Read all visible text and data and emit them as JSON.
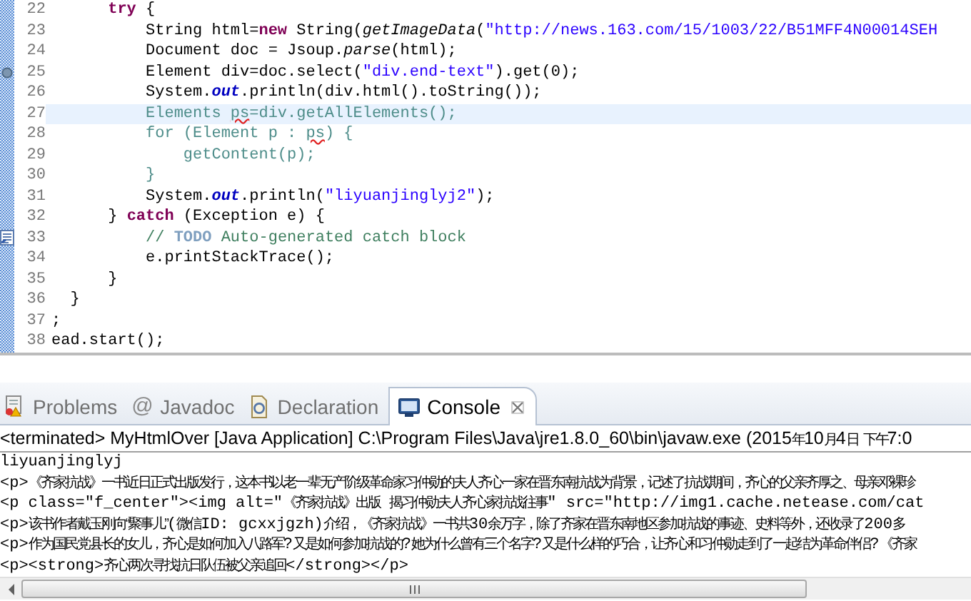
{
  "editor": {
    "lines": [
      {
        "number": "22",
        "breakpoint": false,
        "task": false,
        "current": false,
        "tokens": [
          {
            "kind": "keyword",
            "text": "      try"
          },
          {
            "kind": "plain",
            "text": " {"
          }
        ]
      },
      {
        "number": "23",
        "breakpoint": false,
        "task": false,
        "current": false,
        "tokens": [
          {
            "kind": "plain",
            "text": "          String html="
          },
          {
            "kind": "keyword",
            "text": "new"
          },
          {
            "kind": "plain",
            "text": " String("
          },
          {
            "kind": "static",
            "text": "getImageData"
          },
          {
            "kind": "plain",
            "text": "("
          },
          {
            "kind": "string",
            "text": "\"http://news.163.com/15/1003/22/B51MFF4N00014SEH"
          }
        ]
      },
      {
        "number": "24",
        "breakpoint": false,
        "task": false,
        "current": false,
        "tokens": [
          {
            "kind": "plain",
            "text": "          Document doc = Jsoup."
          },
          {
            "kind": "static",
            "text": "parse"
          },
          {
            "kind": "plain",
            "text": "(html);"
          }
        ]
      },
      {
        "number": "25",
        "breakpoint": true,
        "task": false,
        "current": false,
        "tokens": [
          {
            "kind": "plain",
            "text": "          Element div=doc.select("
          },
          {
            "kind": "string",
            "text": "\"div.end-text\""
          },
          {
            "kind": "plain",
            "text": ").get(0);"
          }
        ]
      },
      {
        "number": "26",
        "breakpoint": false,
        "task": false,
        "current": false,
        "tokens": [
          {
            "kind": "plain",
            "text": "          System."
          },
          {
            "kind": "field",
            "text": "out"
          },
          {
            "kind": "plain",
            "text": ".println(div.html().toString());"
          }
        ]
      },
      {
        "number": "27",
        "breakpoint": false,
        "task": false,
        "current": true,
        "tokens": [
          {
            "kind": "dim",
            "text": "          Elements "
          },
          {
            "kind": "error",
            "text": "ps"
          },
          {
            "kind": "dim",
            "text": "=div.getAllElements();"
          }
        ]
      },
      {
        "number": "28",
        "breakpoint": false,
        "task": false,
        "current": false,
        "tokens": [
          {
            "kind": "dim",
            "text": "          for (Element p : "
          },
          {
            "kind": "error",
            "text": "ps"
          },
          {
            "kind": "dim",
            "text": ") {"
          }
        ]
      },
      {
        "number": "29",
        "breakpoint": false,
        "task": false,
        "current": false,
        "tokens": [
          {
            "kind": "dim",
            "text": "              getContent(p);"
          }
        ]
      },
      {
        "number": "30",
        "breakpoint": false,
        "task": false,
        "current": false,
        "tokens": [
          {
            "kind": "dim",
            "text": "          }"
          }
        ]
      },
      {
        "number": "31",
        "breakpoint": false,
        "task": false,
        "current": false,
        "tokens": [
          {
            "kind": "plain",
            "text": "          System."
          },
          {
            "kind": "field",
            "text": "out"
          },
          {
            "kind": "plain",
            "text": ".println("
          },
          {
            "kind": "string",
            "text": "\"liyuanjinglyj2\""
          },
          {
            "kind": "plain",
            "text": ");"
          }
        ]
      },
      {
        "number": "32",
        "breakpoint": false,
        "task": false,
        "current": false,
        "tokens": [
          {
            "kind": "plain",
            "text": "      } "
          },
          {
            "kind": "keyword",
            "text": "catch"
          },
          {
            "kind": "plain",
            "text": " (Exception e) {"
          }
        ]
      },
      {
        "number": "33",
        "breakpoint": false,
        "task": true,
        "current": false,
        "tokens": [
          {
            "kind": "comment",
            "text": "          // "
          },
          {
            "kind": "todo",
            "text": "TODO"
          },
          {
            "kind": "comment",
            "text": " Auto-generated catch block"
          }
        ]
      },
      {
        "number": "34",
        "breakpoint": false,
        "task": false,
        "current": false,
        "tokens": [
          {
            "kind": "plain",
            "text": "          e.printStackTrace();"
          }
        ]
      },
      {
        "number": "35",
        "breakpoint": false,
        "task": false,
        "current": false,
        "tokens": [
          {
            "kind": "plain",
            "text": "      }"
          }
        ]
      },
      {
        "number": "36",
        "breakpoint": false,
        "task": false,
        "current": false,
        "tokens": [
          {
            "kind": "plain",
            "text": "  }"
          }
        ]
      },
      {
        "number": "37",
        "breakpoint": false,
        "task": false,
        "current": false,
        "tokens": [
          {
            "kind": "plain",
            "text": ";"
          }
        ]
      },
      {
        "number": "38",
        "breakpoint": false,
        "task": false,
        "current": false,
        "tokens": [
          {
            "kind": "plain",
            "text": "ead.start();"
          }
        ]
      }
    ]
  },
  "bottom_panel": {
    "tabs": [
      {
        "label": "Problems",
        "selected": false
      },
      {
        "label": "Javadoc",
        "glyph": "@",
        "selected": false
      },
      {
        "label": "Declaration",
        "selected": false
      },
      {
        "label": "Console",
        "selected": true
      }
    ],
    "console": {
      "status": "<terminated> MyHtmlOver [Java Application] C:\\Program Files\\Java\\jre1.8.0_60\\bin\\javaw.exe (2015年10月4日 下午7:0",
      "lines": [
        "liyuanjinglyj",
        "<p>《齐家抗战》一书近日正式出版发行，这本书以老一辈无产阶级革命家习仲勋的夫人齐心一家在晋东南抗战为背景，记述了抗战期间，齐心的父亲齐厚之、母亲邓裸珍",
        "<p class=\"f_center\"><img alt=\"《齐家抗战》出版 揭习仲勋夫人齐心家抗战往事\" src=\"http://img1.cache.netease.com/cat",
        "<p>该书作者戴玉刚向“聚事儿”(微信ID: gcxxjgzh)介绍，《齐家抗战》一书共30余万字，除了齐家在晋东南地区参加抗战的事迹、史料等外，还收录了200多",
        "<p>作为国民党县长的女儿，齐心是如何加入八路军?又是如何参加抗战的?她为什么曾有三个名字?又是什么样的巧合，让齐心和习仲勋走到了一起结为革命伴侣?《齐家",
        "<p><strong>齐心两次寻找抗日队伍被父亲追回</strong></p>"
      ]
    }
  }
}
